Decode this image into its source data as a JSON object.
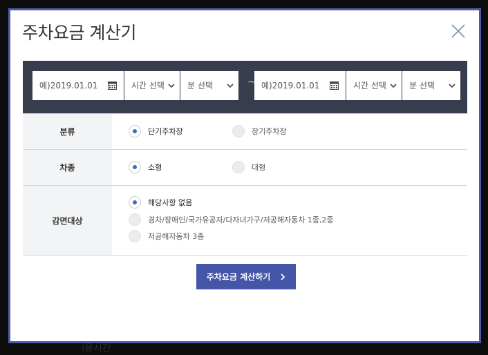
{
  "backdrop": {
    "fragment_text": "Ⅰ용시간"
  },
  "modal": {
    "title": "주차요금 계산기"
  },
  "start": {
    "date_placeholder": "예)2019.01.01",
    "time_label": "시간 선택",
    "minute_label": "분 선택"
  },
  "range_separator": "~",
  "end": {
    "date_placeholder": "예)2019.01.01",
    "time_label": "시간 선택",
    "minute_label": "분 선택"
  },
  "options": {
    "category": {
      "label": "분류",
      "choices": [
        {
          "label": "단기주차장",
          "selected": true
        },
        {
          "label": "장기주차장",
          "selected": false
        }
      ]
    },
    "vehicle": {
      "label": "차종",
      "choices": [
        {
          "label": "소형",
          "selected": true
        },
        {
          "label": "대형",
          "selected": false
        }
      ]
    },
    "discount": {
      "label": "감면대상",
      "choices": [
        {
          "label": "해당사항 없음",
          "selected": true
        },
        {
          "label": "경차/장애인/국가유공자/다자녀가구/저공해자동차 1종,2종",
          "selected": false
        },
        {
          "label": "저공해자동차 3종",
          "selected": false
        }
      ]
    }
  },
  "calculate_button": {
    "label": "주차요금 계산하기",
    "arrow": "›"
  },
  "colors": {
    "primary": "#4555a7",
    "modal_border": "#4c5ba8",
    "date_bar": "#383d4e",
    "radio_dot": "#4464c8",
    "label_bg": "#f3f4f6"
  },
  "icons": [
    "close-icon",
    "calendar-icon",
    "chevron-down-icon",
    "radio-icon",
    "chevron-right-icon"
  ]
}
